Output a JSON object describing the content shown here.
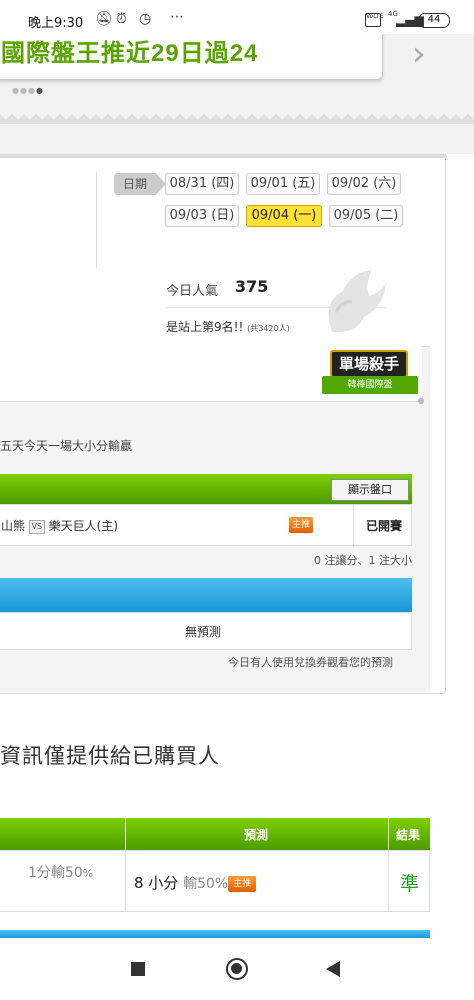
{
  "status": {
    "time": "晚上9:30",
    "icons": [
      "bell-off-icon",
      "alarm-icon",
      "timer-icon",
      "more-dots-icon"
    ],
    "network": "VoLTE",
    "signal": "4G",
    "battery": "44"
  },
  "banner": {
    "title": "國際盤王推近29日過24",
    "next_glyph": "›"
  },
  "dates": {
    "label": "日期",
    "items": [
      "08/31 (四)",
      "09/01 (五)",
      "09/02 (六)",
      "09/03 (日)",
      "09/04 (一)",
      "09/05 (二)"
    ],
    "active": "09/04 (一)"
  },
  "popularity": {
    "label": "今日人氣",
    "value": "375",
    "rank": "是站上第9名!!",
    "total": "(共3420人)"
  },
  "badge": {
    "title": "單場殺手",
    "subtitle": "韓棒國際盤"
  },
  "pick": {
    "description": "五天今天一場大小分輸贏",
    "show_button": "顯示盤口",
    "team_away": "山熊",
    "vs": "VS",
    "team_home": "樂天巨人(主)",
    "tag": "主推",
    "status": "已開賽",
    "counts": "0 注讓分、1 注大小",
    "no_prediction": "無預測",
    "voucher_note": "今日有人使用兌換券觀看您的預測"
  },
  "notice": "資訊僅提供給已購買人",
  "table": {
    "headers": [
      "預測",
      "結果"
    ],
    "row": {
      "line": "1分輸50",
      "line_unit": "%",
      "prediction_value": "8 小分",
      "prediction_odds": "輸50%",
      "prediction_tag": "主推",
      "result": "準"
    }
  },
  "colors": {
    "green": "#5aa400",
    "blue": "#1897d8",
    "active_date": "#ffe033",
    "tag_orange": "#e05f00"
  }
}
